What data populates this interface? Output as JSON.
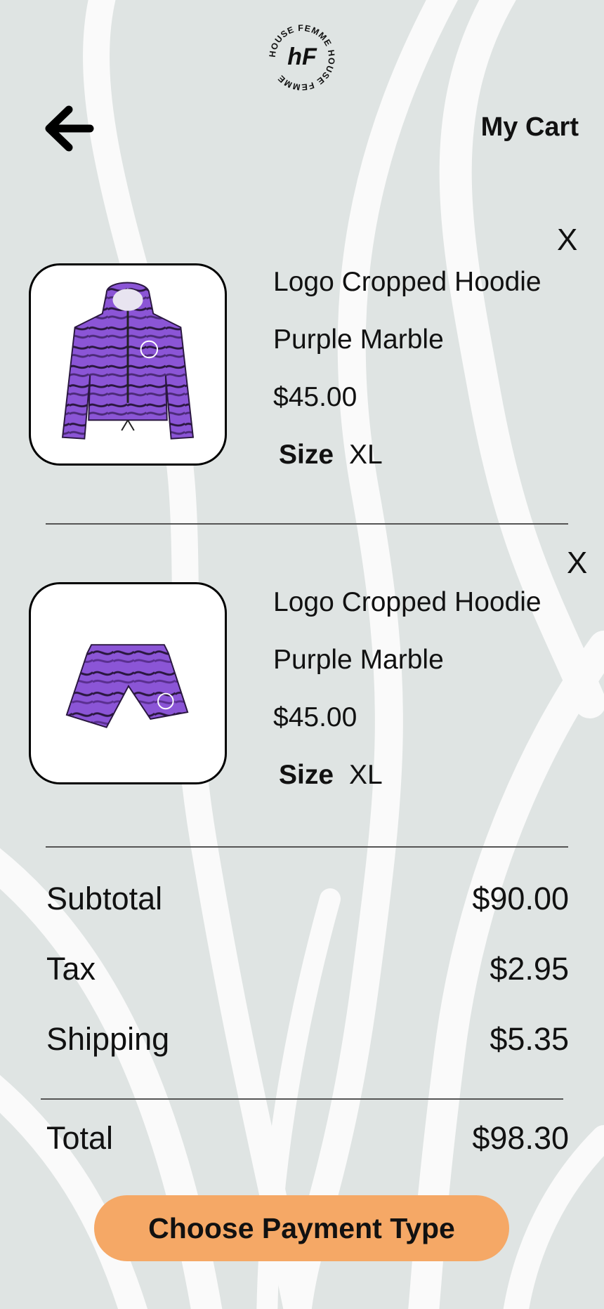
{
  "brand": {
    "logo_text": "HOUSE FEMME HOUSE FEMME",
    "logo_mark": "hF"
  },
  "header": {
    "title": "My Cart"
  },
  "cart": {
    "items": [
      {
        "name": "Logo Cropped Hoodie",
        "color": "Purple Marble",
        "price": "$45.00",
        "size_label": "Size",
        "size": "XL",
        "remove_label": "X",
        "image_icon": "cropped-hoodie"
      },
      {
        "name": "Logo Cropped Hoodie",
        "color": "Purple Marble",
        "price": "$45.00",
        "size_label": "Size",
        "size": "XL",
        "remove_label": "X",
        "image_icon": "shorts"
      }
    ]
  },
  "summary": {
    "subtotal_label": "Subtotal",
    "subtotal": "$90.00",
    "tax_label": "Tax",
    "tax": "$2.95",
    "shipping_label": "Shipping",
    "shipping": "$5.35",
    "total_label": "Total",
    "total": "$98.30"
  },
  "actions": {
    "pay_label": "Choose Payment Type"
  },
  "colors": {
    "background": "#dfe4e3",
    "accent": "#f5a866",
    "product": "#8b55d6"
  }
}
